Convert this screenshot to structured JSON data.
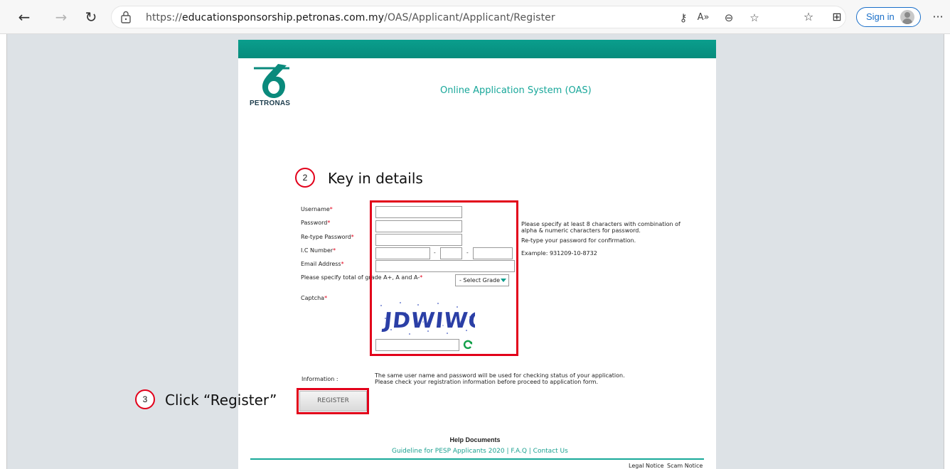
{
  "browser": {
    "url_prefix": "https://",
    "url_host": "educationsponsorship.petronas.com.my",
    "url_path": "/OAS/Applicant/Applicant/Register",
    "signin_label": "Sign in",
    "more_label": "···"
  },
  "header": {
    "brand": "PETRONAS",
    "system_title": "Online Application System (OAS)"
  },
  "annotations": {
    "step2_number": "2",
    "step2_text": "Key in details",
    "step3_number": "3",
    "step3_text": "Click “Register”"
  },
  "form": {
    "username_label": "Username",
    "password_label": "Password",
    "retype_label": "Re-type Password",
    "ic_label": "I.C Number",
    "email_label": "Email Address",
    "grade_label": "Please specify total of grade A+, A and A-",
    "captcha_label": "Captcha",
    "required_mark": "*",
    "ic_separator": "-",
    "password_hint_line1": "Please specify at least 8 characters with combination of",
    "password_hint_line2": "alpha & numeric characters for password.",
    "retype_hint": "Re-type your password for confirmation.",
    "ic_example": "Example: 931209-10-8732",
    "grade_select": "- Select Grade -",
    "captcha_text": "JDWIWQ",
    "info_label": "Information :",
    "info_line1": "The same user name and password will be used for checking status of your application.",
    "info_line2": "Please check your registration information before proceed to application form.",
    "register_label": "REGISTER"
  },
  "help": {
    "title": "Help Documents",
    "links": "Guideline for PESP Applicants 2020 | F.A.Q | Contact Us"
  },
  "footer": {
    "legal": "Legal Notice",
    "scam": "Scam Notice"
  },
  "colors": {
    "brand_teal": "#0a9e8d",
    "annotation_red": "#e2001a",
    "link_teal": "#1ca191"
  }
}
